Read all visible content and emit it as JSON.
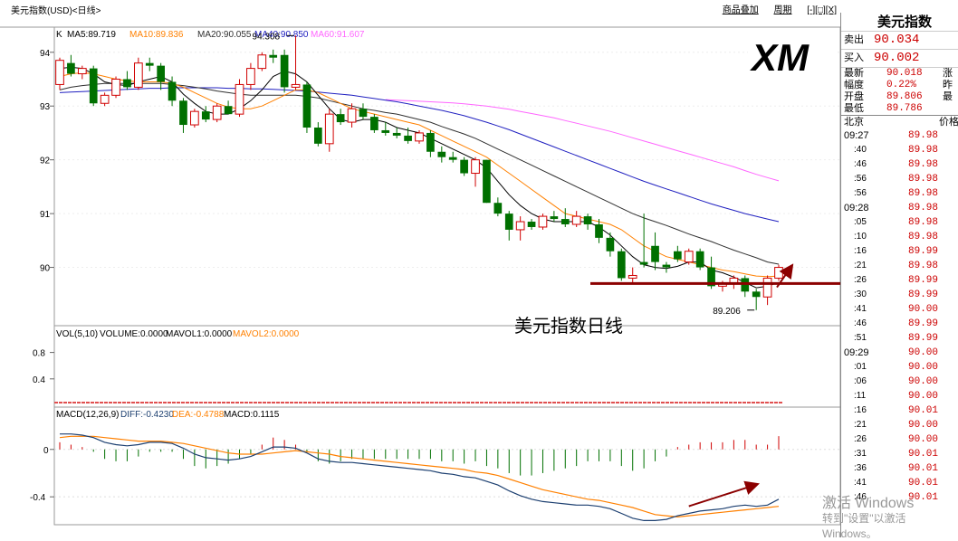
{
  "window": {
    "title": "美元指数(USD)<日线>",
    "top_links": [
      "商品叠加",
      "周期",
      "[-][□][X]"
    ]
  },
  "logo_text": "XM",
  "colors": {
    "up": "#d00000",
    "down": "#007000",
    "ma5": "#000000",
    "ma10": "#ff8000",
    "ma20": "#303030",
    "ma40": "#2020c0",
    "ma60": "#ff66ff",
    "diff": "#1c3f70",
    "dea": "#ff8000",
    "annotation": "#8b0000"
  },
  "indicator_header": {
    "k_label": "K",
    "ma5": "MA5:89.719",
    "ma10": "MA10:89.836",
    "ma20": "MA20:90.055",
    "ma40": "MA40:90.850",
    "ma60": "MA60:91.607"
  },
  "volume_header": {
    "vol": "VOL(5,10)",
    "volume": "VOLUME:0.0000",
    "mavol1": "MAVOL1:0.0000",
    "mavol2": "MAVOL2:0.0000"
  },
  "macd_header": {
    "macd": "MACD(12,26,9)",
    "diff": "DIFF:-0.4230",
    "dea": "DEA:-0.4788",
    "macd_val": "MACD:0.1115"
  },
  "annotation": {
    "label": "美元指数日线",
    "high_label": "94.308",
    "low_label": "89.206",
    "support_level": 89.7
  },
  "chart_data": [
    {
      "type": "candlestick",
      "title": "",
      "ylim": [
        89.0,
        94.4
      ],
      "y_ticks": [
        94,
        93,
        92,
        91,
        90
      ],
      "ohlc": [
        [
          93.4,
          93.9,
          93.3,
          93.85
        ],
        [
          93.8,
          93.95,
          93.55,
          93.6
        ],
        [
          93.6,
          93.75,
          93.5,
          93.7
        ],
        [
          93.7,
          93.75,
          93.0,
          93.05
        ],
        [
          93.05,
          93.25,
          93.0,
          93.2
        ],
        [
          93.2,
          93.55,
          93.15,
          93.5
        ],
        [
          93.5,
          93.65,
          93.3,
          93.35
        ],
        [
          93.35,
          93.9,
          93.3,
          93.8
        ],
        [
          93.8,
          93.9,
          93.65,
          93.75
        ],
        [
          93.75,
          93.8,
          93.3,
          93.45
        ],
        [
          93.45,
          93.55,
          93.0,
          93.1
        ],
        [
          93.1,
          93.15,
          92.5,
          92.65
        ],
        [
          92.65,
          92.95,
          92.6,
          92.9
        ],
        [
          92.9,
          93.0,
          92.7,
          92.75
        ],
        [
          92.75,
          93.05,
          92.7,
          93.0
        ],
        [
          93.0,
          93.1,
          92.85,
          92.85
        ],
        [
          92.85,
          93.5,
          92.8,
          93.4
        ],
        [
          93.4,
          93.8,
          93.3,
          93.7
        ],
        [
          93.7,
          94.0,
          93.65,
          93.95
        ],
        [
          93.95,
          94.05,
          93.8,
          93.9
        ],
        [
          93.95,
          94.05,
          93.25,
          93.35
        ],
        [
          93.35,
          94.31,
          93.3,
          93.4
        ],
        [
          93.4,
          93.45,
          92.5,
          92.6
        ],
        [
          92.6,
          92.7,
          92.25,
          92.3
        ],
        [
          92.3,
          92.95,
          92.15,
          92.85
        ],
        [
          92.85,
          92.95,
          92.65,
          92.7
        ],
        [
          92.7,
          93.05,
          92.6,
          92.95
        ],
        [
          92.95,
          93.05,
          92.75,
          92.8
        ],
        [
          92.8,
          92.85,
          92.5,
          92.55
        ],
        [
          92.55,
          92.7,
          92.45,
          92.5
        ],
        [
          92.5,
          92.6,
          92.4,
          92.45
        ],
        [
          92.45,
          92.6,
          92.3,
          92.35
        ],
        [
          92.35,
          92.55,
          92.3,
          92.5
        ],
        [
          92.5,
          92.55,
          92.05,
          92.15
        ],
        [
          92.15,
          92.25,
          91.95,
          92.05
        ],
        [
          92.05,
          92.15,
          91.95,
          92.0
        ],
        [
          92.0,
          92.05,
          91.7,
          91.75
        ],
        [
          91.75,
          92.05,
          91.5,
          92.0
        ],
        [
          92.0,
          92.0,
          91.2,
          91.2
        ],
        [
          91.2,
          91.3,
          90.95,
          91.0
        ],
        [
          91.0,
          91.05,
          90.5,
          90.7
        ],
        [
          90.7,
          90.95,
          90.5,
          90.85
        ],
        [
          90.85,
          90.9,
          90.7,
          90.75
        ],
        [
          90.75,
          91.0,
          90.7,
          90.95
        ],
        [
          90.95,
          91.05,
          90.85,
          90.9
        ],
        [
          90.9,
          91.1,
          90.75,
          90.8
        ],
        [
          90.8,
          91.05,
          90.75,
          90.95
        ],
        [
          90.95,
          91.0,
          90.7,
          90.8
        ],
        [
          90.8,
          90.9,
          90.45,
          90.55
        ],
        [
          90.55,
          90.65,
          90.2,
          90.3
        ],
        [
          90.3,
          90.35,
          89.75,
          89.8
        ],
        [
          89.8,
          90.0,
          89.7,
          89.85
        ],
        [
          90.1,
          91.0,
          90.0,
          90.05
        ],
        [
          90.4,
          90.65,
          89.95,
          90.1
        ],
        [
          90.05,
          90.1,
          89.9,
          90.0
        ],
        [
          90.3,
          90.4,
          90.1,
          90.15
        ],
        [
          90.1,
          90.35,
          90.05,
          90.3
        ],
        [
          90.3,
          90.35,
          89.95,
          90.0
        ],
        [
          90.0,
          90.2,
          89.6,
          89.65
        ],
        [
          89.65,
          89.75,
          89.55,
          89.7
        ],
        [
          89.7,
          89.85,
          89.6,
          89.8
        ],
        [
          89.8,
          89.85,
          89.45,
          89.55
        ],
        [
          89.55,
          89.6,
          89.206,
          89.45
        ],
        [
          89.45,
          89.85,
          89.3,
          89.8
        ],
        [
          89.8,
          90.05,
          89.75,
          90.0
        ]
      ],
      "ma5": [
        93.7,
        93.72,
        93.7,
        93.6,
        93.45,
        93.4,
        93.38,
        93.45,
        93.5,
        93.55,
        93.45,
        93.22,
        93.05,
        92.9,
        92.85,
        92.85,
        92.95,
        93.1,
        93.3,
        93.55,
        93.65,
        93.6,
        93.45,
        93.2,
        92.95,
        92.75,
        92.7,
        92.75,
        92.75,
        92.7,
        92.6,
        92.55,
        92.5,
        92.4,
        92.3,
        92.2,
        92.1,
        92.0,
        91.85,
        91.6,
        91.35,
        91.15,
        91.0,
        90.9,
        90.85,
        90.85,
        90.85,
        90.85,
        90.75,
        90.6,
        90.4,
        90.2,
        90.05,
        90.0,
        89.98,
        90.02,
        90.1,
        90.1,
        89.95,
        89.9,
        89.82,
        89.72,
        89.62,
        89.65,
        89.72
      ],
      "ma10": [
        93.55,
        93.6,
        93.62,
        93.6,
        93.55,
        93.5,
        93.47,
        93.45,
        93.45,
        93.45,
        93.42,
        93.35,
        93.25,
        93.15,
        93.05,
        92.98,
        92.95,
        92.95,
        93.0,
        93.1,
        93.2,
        93.3,
        93.3,
        93.25,
        93.15,
        93.05,
        92.95,
        92.9,
        92.85,
        92.8,
        92.75,
        92.7,
        92.65,
        92.55,
        92.45,
        92.35,
        92.25,
        92.15,
        92.05,
        91.9,
        91.75,
        91.6,
        91.45,
        91.3,
        91.15,
        91.0,
        90.95,
        90.9,
        90.85,
        90.8,
        90.7,
        90.55,
        90.4,
        90.3,
        90.2,
        90.15,
        90.1,
        90.05,
        90.0,
        89.95,
        89.92,
        89.88,
        89.84,
        89.83,
        89.84
      ],
      "ma20": [
        93.3,
        93.35,
        93.38,
        93.4,
        93.42,
        93.42,
        93.42,
        93.42,
        93.42,
        93.42,
        93.4,
        93.38,
        93.35,
        93.32,
        93.28,
        93.25,
        93.22,
        93.2,
        93.2,
        93.2,
        93.2,
        93.2,
        93.18,
        93.15,
        93.1,
        93.05,
        93.0,
        92.95,
        92.92,
        92.88,
        92.85,
        92.8,
        92.75,
        92.7,
        92.62,
        92.55,
        92.48,
        92.4,
        92.3,
        92.2,
        92.1,
        92.0,
        91.9,
        91.8,
        91.7,
        91.6,
        91.5,
        91.4,
        91.3,
        91.2,
        91.1,
        91.0,
        90.92,
        90.85,
        90.78,
        90.7,
        90.62,
        90.55,
        90.48,
        90.4,
        90.32,
        90.25,
        90.18,
        90.1,
        90.06
      ],
      "ma40": [
        93.25,
        93.26,
        93.27,
        93.28,
        93.29,
        93.3,
        93.31,
        93.32,
        93.33,
        93.33,
        93.34,
        93.34,
        93.34,
        93.34,
        93.34,
        93.33,
        93.33,
        93.32,
        93.32,
        93.31,
        93.3,
        93.29,
        93.28,
        93.26,
        93.24,
        93.22,
        93.2,
        93.17,
        93.14,
        93.11,
        93.08,
        93.04,
        93.0,
        92.96,
        92.92,
        92.87,
        92.82,
        92.76,
        92.7,
        92.63,
        92.56,
        92.48,
        92.4,
        92.32,
        92.24,
        92.16,
        92.08,
        92.0,
        91.92,
        91.84,
        91.76,
        91.68,
        91.6,
        91.53,
        91.46,
        91.39,
        91.32,
        91.25,
        91.18,
        91.12,
        91.06,
        91.0,
        90.95,
        90.9,
        90.85
      ],
      "ma60": [
        null,
        null,
        null,
        null,
        null,
        null,
        null,
        null,
        null,
        null,
        null,
        null,
        null,
        null,
        null,
        null,
        null,
        null,
        null,
        null,
        null,
        null,
        null,
        null,
        null,
        null,
        null,
        null,
        null,
        93.12,
        93.11,
        93.1,
        93.09,
        93.08,
        93.07,
        93.06,
        93.04,
        93.02,
        93.0,
        92.97,
        92.94,
        92.9,
        92.86,
        92.82,
        92.78,
        92.73,
        92.68,
        92.63,
        92.58,
        92.53,
        92.47,
        92.41,
        92.35,
        92.29,
        92.23,
        92.17,
        92.11,
        92.05,
        91.99,
        91.93,
        91.87,
        91.8,
        91.73,
        91.67,
        91.61
      ]
    },
    {
      "type": "bar",
      "title": "",
      "y_ticks": [
        0.8,
        0.4
      ],
      "ylim": [
        0,
        1.0
      ],
      "values_note": "",
      "values": []
    },
    {
      "type": "line",
      "title": "",
      "ylim": [
        -0.62,
        0.25
      ],
      "y_ticks": [
        0,
        -0.4
      ],
      "diff": [
        0.13,
        0.13,
        0.12,
        0.1,
        0.06,
        0.04,
        0.03,
        0.04,
        0.06,
        0.06,
        0.05,
        0.01,
        -0.04,
        -0.07,
        -0.08,
        -0.09,
        -0.08,
        -0.06,
        -0.02,
        0.02,
        0.02,
        0.01,
        -0.03,
        -0.08,
        -0.1,
        -0.11,
        -0.11,
        -0.12,
        -0.13,
        -0.14,
        -0.15,
        -0.16,
        -0.17,
        -0.18,
        -0.2,
        -0.21,
        -0.23,
        -0.24,
        -0.27,
        -0.3,
        -0.35,
        -0.39,
        -0.42,
        -0.44,
        -0.45,
        -0.46,
        -0.47,
        -0.47,
        -0.48,
        -0.5,
        -0.54,
        -0.58,
        -0.6,
        -0.6,
        -0.59,
        -0.56,
        -0.54,
        -0.52,
        -0.51,
        -0.5,
        -0.48,
        -0.47,
        -0.48,
        -0.47,
        -0.42
      ],
      "dea": [
        0.1,
        0.11,
        0.11,
        0.11,
        0.1,
        0.09,
        0.08,
        0.07,
        0.07,
        0.07,
        0.06,
        0.05,
        0.03,
        0.01,
        -0.01,
        -0.03,
        -0.04,
        -0.04,
        -0.04,
        -0.03,
        -0.02,
        -0.01,
        -0.02,
        -0.03,
        -0.04,
        -0.06,
        -0.07,
        -0.08,
        -0.09,
        -0.1,
        -0.11,
        -0.12,
        -0.13,
        -0.14,
        -0.15,
        -0.16,
        -0.17,
        -0.19,
        -0.2,
        -0.22,
        -0.25,
        -0.28,
        -0.31,
        -0.34,
        -0.36,
        -0.38,
        -0.4,
        -0.42,
        -0.43,
        -0.45,
        -0.47,
        -0.49,
        -0.52,
        -0.55,
        -0.56,
        -0.57,
        -0.56,
        -0.55,
        -0.54,
        -0.53,
        -0.52,
        -0.51,
        -0.5,
        -0.49,
        -0.48
      ],
      "macd": [
        0.06,
        0.04,
        0.02,
        -0.02,
        -0.08,
        -0.1,
        -0.1,
        -0.06,
        -0.02,
        -0.02,
        -0.02,
        -0.08,
        -0.14,
        -0.16,
        -0.14,
        -0.12,
        -0.08,
        -0.04,
        0.04,
        0.1,
        0.08,
        0.04,
        -0.02,
        -0.1,
        -0.12,
        -0.1,
        -0.08,
        -0.08,
        -0.08,
        -0.08,
        -0.08,
        -0.08,
        -0.08,
        -0.08,
        -0.1,
        -0.1,
        -0.12,
        -0.1,
        -0.14,
        -0.16,
        -0.2,
        -0.22,
        -0.22,
        -0.2,
        -0.18,
        -0.16,
        -0.14,
        -0.1,
        -0.1,
        -0.1,
        -0.14,
        -0.18,
        -0.16,
        -0.1,
        -0.06,
        0.02,
        0.04,
        0.06,
        0.06,
        0.06,
        0.08,
        0.08,
        0.04,
        0.04,
        0.1115
      ]
    }
  ],
  "quote_panel": {
    "title": "美元指数",
    "sell_label": "卖出",
    "sell_value": "90.034",
    "buy_label": "买入",
    "buy_value": "90.002",
    "rows": [
      {
        "k": "最新",
        "v": "90.018",
        "tail": "涨"
      },
      {
        "k": "幅度",
        "v": "0.22%",
        "tail": "昨"
      },
      {
        "k": "开盘",
        "v": "89.806",
        "tail": "最"
      },
      {
        "k": "最低",
        "v": "89.786",
        "tail": ""
      }
    ],
    "ticks_head": {
      "k": "北京",
      "v": "价格"
    },
    "ticks": [
      {
        "t": "09:27",
        "p": "89.98",
        "major": true
      },
      {
        "t": ":40",
        "p": "89.98"
      },
      {
        "t": ":46",
        "p": "89.98"
      },
      {
        "t": ":56",
        "p": "89.98"
      },
      {
        "t": ":56",
        "p": "89.98"
      },
      {
        "t": "09:28",
        "p": "89.98",
        "major": true
      },
      {
        "t": ":05",
        "p": "89.98"
      },
      {
        "t": ":10",
        "p": "89.98"
      },
      {
        "t": ":16",
        "p": "89.99"
      },
      {
        "t": ":21",
        "p": "89.98"
      },
      {
        "t": ":26",
        "p": "89.99"
      },
      {
        "t": ":30",
        "p": "89.99"
      },
      {
        "t": ":41",
        "p": "90.00"
      },
      {
        "t": ":46",
        "p": "89.99"
      },
      {
        "t": ":51",
        "p": "89.99"
      },
      {
        "t": "09:29",
        "p": "90.00",
        "major": true
      },
      {
        "t": ":01",
        "p": "90.00"
      },
      {
        "t": ":06",
        "p": "90.00"
      },
      {
        "t": ":11",
        "p": "90.00"
      },
      {
        "t": ":16",
        "p": "90.01"
      },
      {
        "t": ":21",
        "p": "90.00"
      },
      {
        "t": ":26",
        "p": "90.00"
      },
      {
        "t": ":31",
        "p": "90.01"
      },
      {
        "t": ":36",
        "p": "90.01"
      },
      {
        "t": ":41",
        "p": "90.01"
      },
      {
        "t": ":46",
        "p": "90.01"
      }
    ]
  },
  "watermark": {
    "line1": "激活 Windows",
    "line2": "转到\"设置\"以激活 Windows。"
  }
}
